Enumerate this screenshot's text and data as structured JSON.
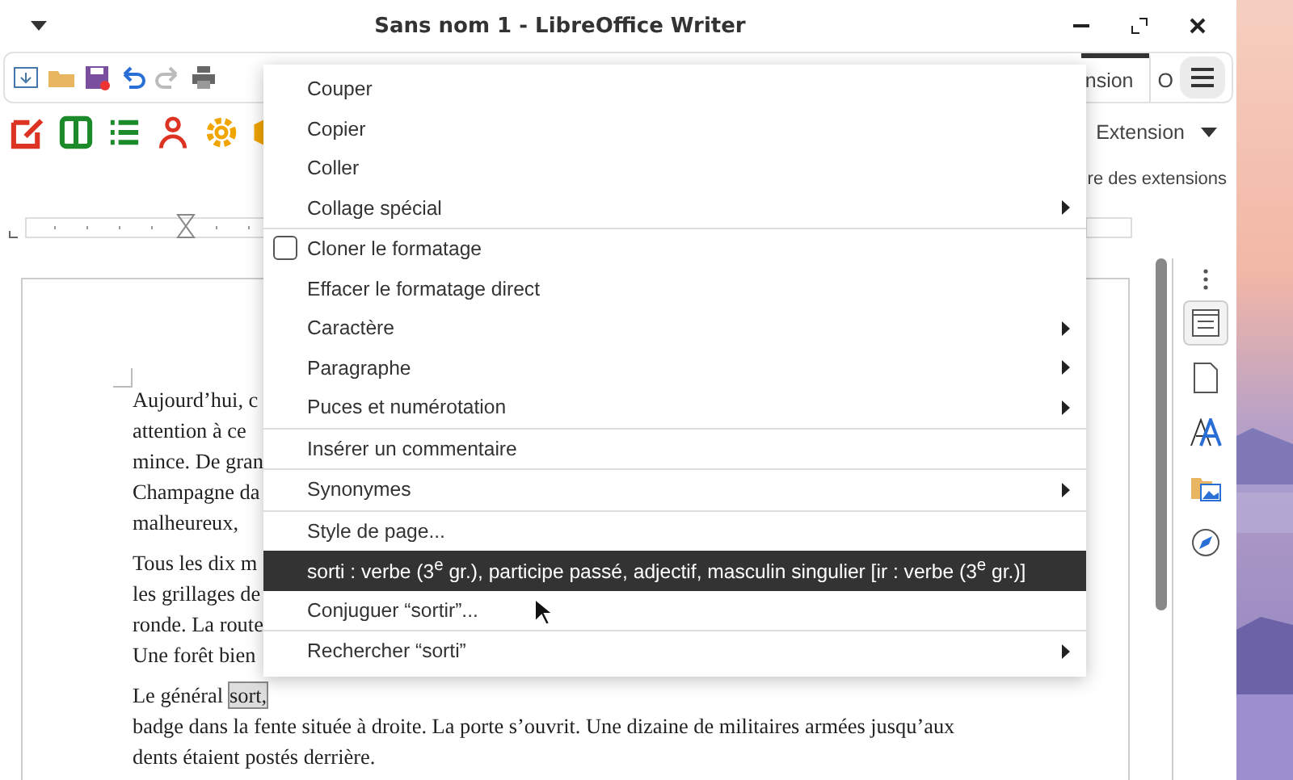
{
  "window": {
    "title": "Sans nom 1 - LibreOffice Writer"
  },
  "toolbar": {
    "tabs": [
      {
        "label": "nsion",
        "selected": true
      },
      {
        "label": "O",
        "selected": false
      }
    ]
  },
  "deck": {
    "dropdown": "Extension",
    "text": "re des extensions"
  },
  "document": {
    "paragraphs": [
      {
        "lines": [
          "Aujourd’hui, c",
          "attention à ce",
          "mince. De gran",
          "Champagne da",
          "malheureux,"
        ]
      },
      {
        "lines": [
          "Tous les dix m",
          "les grillages de",
          "ronde. La route",
          "Une forêt bien"
        ]
      },
      {
        "lines": [
          "Le général",
          "badge dans la fente située à droite. La porte s’ouvrit. Une dizaine de militaires armées jusqu’aux",
          "dents étaient postés derrière."
        ],
        "marked_word": "sort,"
      }
    ]
  },
  "context_menu": {
    "groups": [
      {
        "items": [
          {
            "label": "Couper",
            "kind": "plain",
            "submenu": false,
            "selected": false
          },
          {
            "label": "Copier",
            "kind": "plain",
            "submenu": false,
            "selected": false
          },
          {
            "label": "Coller",
            "kind": "plain",
            "submenu": false,
            "selected": false
          },
          {
            "label": "Collage spécial",
            "kind": "plain",
            "submenu": true,
            "selected": false
          }
        ]
      },
      {
        "items": [
          {
            "label": "Cloner le formatage",
            "kind": "checkbox",
            "checked": false,
            "submenu": false,
            "selected": false
          },
          {
            "label": "Effacer le formatage direct",
            "kind": "plain",
            "submenu": false,
            "selected": false
          },
          {
            "label": "Caractère",
            "kind": "plain",
            "submenu": true,
            "selected": false
          },
          {
            "label": "Paragraphe",
            "kind": "plain",
            "submenu": true,
            "selected": false
          },
          {
            "label": "Puces et numérotation",
            "kind": "plain",
            "submenu": true,
            "selected": false
          }
        ]
      },
      {
        "items": [
          {
            "label": "Insérer un commentaire",
            "kind": "plain",
            "submenu": false,
            "selected": false
          }
        ]
      },
      {
        "items": [
          {
            "label": "Synonymes",
            "kind": "plain",
            "submenu": true,
            "selected": false
          }
        ]
      },
      {
        "items": [
          {
            "label": "Style de page...",
            "kind": "plain",
            "submenu": false,
            "selected": false
          },
          {
            "label": "sorti :  verbe (3$^{e}$ gr.), participe passé, adjectif, masculin singulier [ir :  verbe (3$^{e}$ gr.)]",
            "kind": "plain",
            "submenu": false,
            "selected": true
          },
          {
            "label": "Conjuguer “sortir”...",
            "kind": "plain",
            "submenu": false,
            "selected": false
          }
        ]
      },
      {
        "items": [
          {
            "label": "Rechercher “sorti”",
            "kind": "plain",
            "submenu": true,
            "selected": false
          }
        ]
      }
    ]
  }
}
